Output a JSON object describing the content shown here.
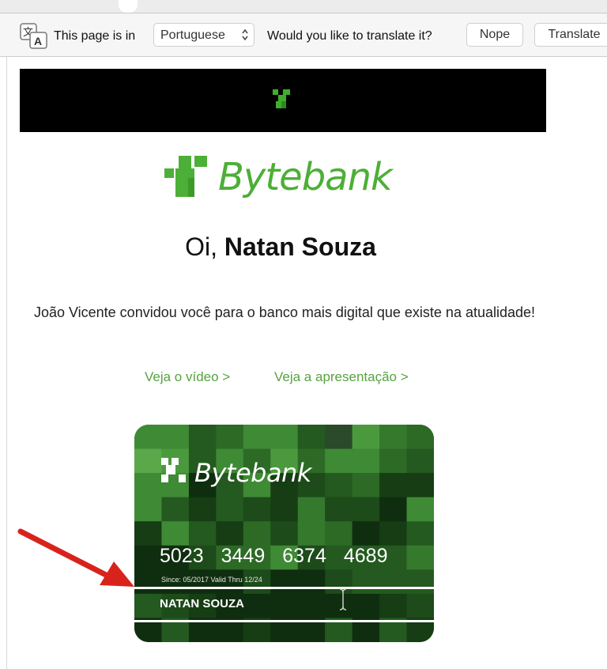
{
  "translate_bar": {
    "prefix": "This page is in",
    "language": "Portuguese",
    "question": "Would you like to translate it?",
    "nope_label": "Nope",
    "translate_label": "Translate"
  },
  "email": {
    "brand": "Bytebank",
    "greeting_prefix": "Oi,",
    "greeting_name": "Natan Souza",
    "intro": "João Vicente convidou você para o banco mais digital que existe na atualidade!",
    "link_video": "Veja o vídeo >",
    "link_presentation": "Veja a apresentação >"
  },
  "card": {
    "brand": "Bytebank",
    "number_groups": [
      "5023",
      "3449",
      "6374",
      "4689"
    ],
    "dates": "Since: 05/2017  Valid Thru 12/24",
    "holder": "NATAN SOUZA"
  },
  "colors": {
    "brand_green": "#4caf37",
    "link_green": "#55a33f",
    "annotation_red": "#d8231c"
  }
}
